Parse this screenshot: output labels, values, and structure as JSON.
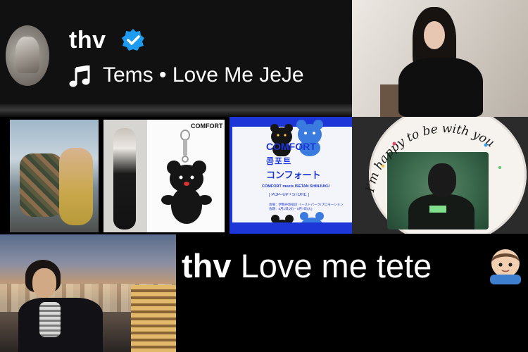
{
  "profile": {
    "username": "thv",
    "now_playing": "Tems • Love Me JeJe"
  },
  "keychain_card": {
    "brand": "COMFORT"
  },
  "poster": {
    "title": "COMFORT",
    "korean": "콤포트",
    "japanese": "コンフォート",
    "subtitle": "COMFORT meets ISETAN SHINJUKU",
    "store": "[ POP–UP • STORE ]",
    "info_line_1": "会場：伊勢丹新宿店 イーストパーク/プロモーション",
    "info_line_2": "会期：5月1日(水) – 5月7日(火)"
  },
  "cake": {
    "message": "I'm happy to be with you"
  },
  "caption": {
    "prefix": "thv",
    "text": "Love me tete"
  },
  "colors": {
    "verified_badge": "#1d9bf0",
    "poster_blue": "#1d36d8",
    "panel_bg": "#111112"
  }
}
